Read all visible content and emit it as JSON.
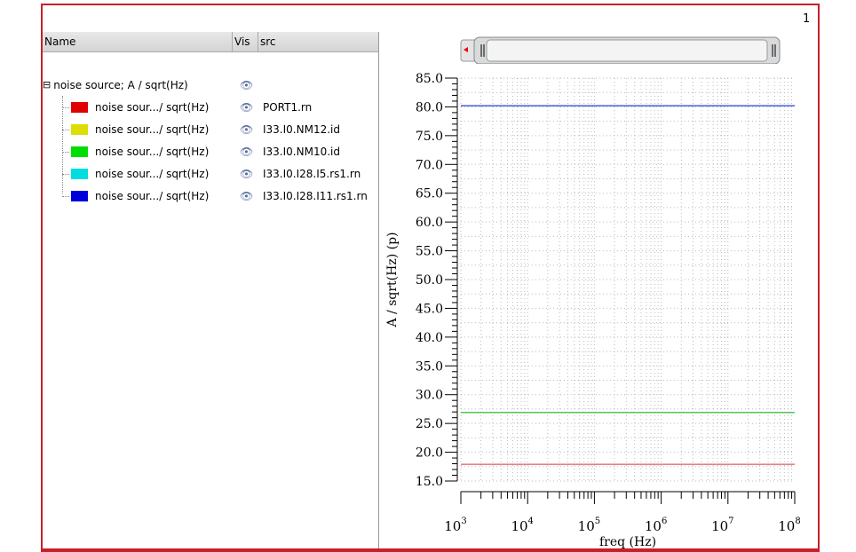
{
  "window": {
    "number": "1"
  },
  "tree": {
    "columns": [
      "Name",
      "Vis",
      "src"
    ],
    "root": {
      "label": "noise source; A / sqrt(Hz)"
    },
    "items": [
      {
        "label": "noise sour.../ sqrt(Hz)",
        "src": "PORT1.rn",
        "color": "#e00000"
      },
      {
        "label": "noise sour.../ sqrt(Hz)",
        "src": "I33.I0.NM12.id",
        "color": "#dddd00"
      },
      {
        "label": "noise sour.../ sqrt(Hz)",
        "src": "I33.I0.NM10.id",
        "color": "#00dd00"
      },
      {
        "label": "noise sour.../ sqrt(Hz)",
        "src": "I33.I0.I28.I5.rs1.rn",
        "color": "#00dddd"
      },
      {
        "label": "noise sour.../ sqrt(Hz)",
        "src": "I33.I0.I28.I11.rs1.rn",
        "color": "#0000dd"
      }
    ]
  },
  "chart_data": {
    "type": "line",
    "xlabel": "freq (Hz)",
    "ylabel": "A / sqrt(Hz) (p)",
    "xscale": "log",
    "xlim": [
      1000,
      100000000
    ],
    "ylim": [
      15,
      85
    ],
    "yticks": [
      "15.0",
      "20.0",
      "25.0",
      "30.0",
      "35.0",
      "40.0",
      "45.0",
      "50.0",
      "55.0",
      "60.0",
      "65.0",
      "70.0",
      "75.0",
      "80.0",
      "85.0"
    ],
    "xticks": [
      {
        "base": "10",
        "exp": "3"
      },
      {
        "base": "10",
        "exp": "4"
      },
      {
        "base": "10",
        "exp": "5"
      },
      {
        "base": "10",
        "exp": "6"
      },
      {
        "base": "10",
        "exp": "7"
      },
      {
        "base": "10",
        "exp": "8"
      }
    ],
    "grid": true,
    "series": [
      {
        "name": "I33.I0.I28.I11.rs1.rn",
        "color": "#2040e0",
        "x": [
          1000,
          100000000
        ],
        "y": [
          80.2,
          80.2
        ]
      },
      {
        "name": "I33.I0.NM10.id",
        "color": "#40c040",
        "x": [
          1000,
          100000000
        ],
        "y": [
          26.9,
          26.9
        ]
      },
      {
        "name": "PORT1.rn",
        "color": "#e07070",
        "x": [
          1000,
          100000000
        ],
        "y": [
          17.9,
          17.9
        ]
      }
    ]
  }
}
